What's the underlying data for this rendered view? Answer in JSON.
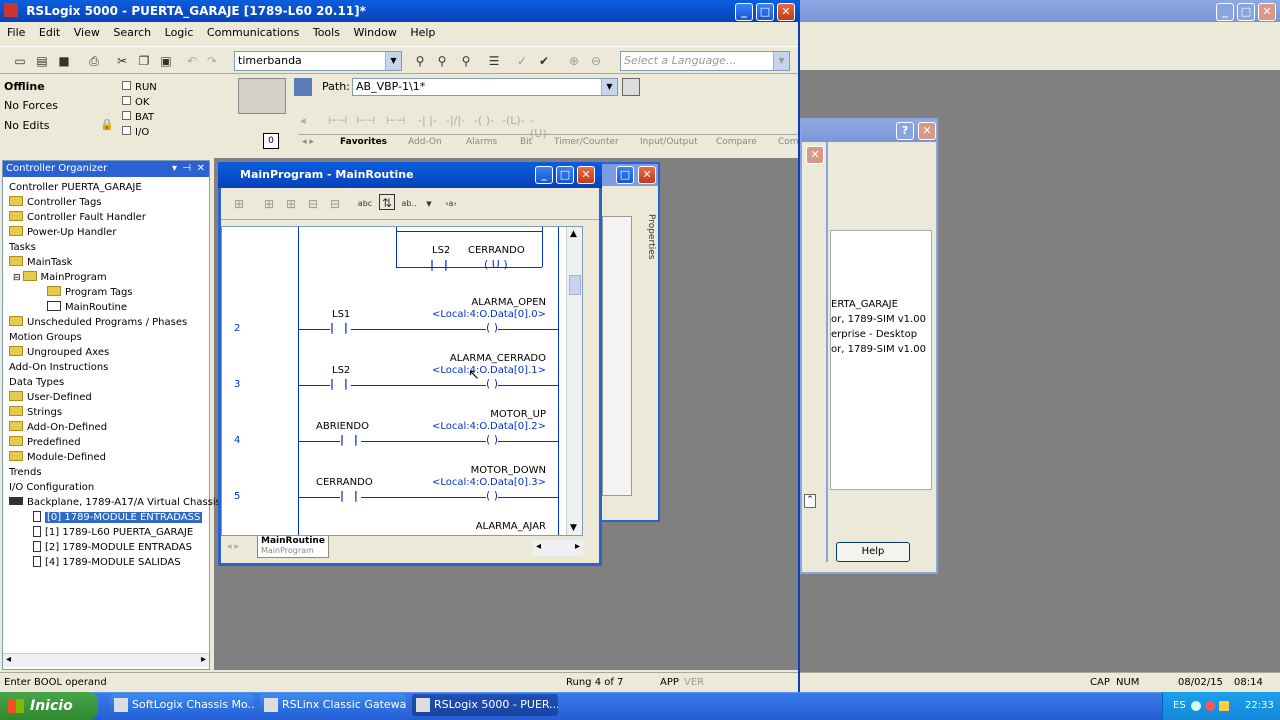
{
  "main_window": {
    "title": "RSLogix 5000 - PUERTA_GARAJE [1789-L60 20.11]*",
    "menu": [
      "File",
      "Edit",
      "View",
      "Search",
      "Logic",
      "Communications",
      "Tools",
      "Window",
      "Help"
    ],
    "search_value": "timerbanda",
    "language_placeholder": "Select a Language...",
    "path_label": "Path:",
    "path_value": "AB_VBP-1\\1*"
  },
  "status_panel": {
    "mode": "Offline",
    "forces": "No Forces",
    "edits": "No Edits",
    "run": "RUN",
    "ok": "OK",
    "bat": "BAT",
    "io": "I/O"
  },
  "instruction_tabs": [
    "Favorites",
    "Add-On",
    "Alarms",
    "Bit",
    "Timer/Counter",
    "Input/Output",
    "Compare",
    "Com"
  ],
  "organizer": {
    "title": "Controller Organizer",
    "items": [
      "Controller PUERTA_GARAJE",
      "Controller Tags",
      "Controller Fault Handler",
      "Power-Up Handler",
      "Tasks",
      "MainTask",
      "MainProgram",
      "Program Tags",
      "MainRoutine",
      "Unscheduled Programs / Phases",
      "Motion Groups",
      "Ungrouped Axes",
      "Add-On Instructions",
      "Data Types",
      "User-Defined",
      "Strings",
      "Add-On-Defined",
      "Predefined",
      "Module-Defined",
      "Trends",
      "I/O Configuration",
      "Backplane, 1789-A17/A Virtual Chassis",
      "[0] 1789-MODULE ENTRADASS",
      "[1] 1789-L60 PUERTA_GARAJE",
      "[2] 1789-MODULE ENTRADAS",
      "[4] 1789-MODULE SALIDAS"
    ]
  },
  "routine_window": {
    "title": "MainProgram - MainRoutine",
    "tab_label": "MainRoutine",
    "tab_sub": "MainProgram",
    "rungs": [
      {
        "num": "",
        "contact": "LS2",
        "coil_tag": "CERRANDO",
        "coil_addr": ""
      },
      {
        "num": "2",
        "contact": "LS1",
        "coil_tag": "ALARMA_OPEN",
        "coil_addr": "<Local:4:O.Data[0].0>"
      },
      {
        "num": "3",
        "contact": "LS2",
        "coil_tag": "ALARMA_CERRADO",
        "coil_addr": "<Local:4:O.Data[0].1>"
      },
      {
        "num": "4",
        "contact": "ABRIENDO",
        "coil_tag": "MOTOR_UP",
        "coil_addr": "<Local:4:O.Data[0].2>"
      },
      {
        "num": "5",
        "contact": "CERRANDO",
        "coil_tag": "MOTOR_DOWN",
        "coil_addr": "<Local:4:O.Data[0].3>"
      },
      {
        "num": "",
        "contact": "",
        "coil_tag": "ALARMA_AJAR",
        "coil_addr": ""
      }
    ]
  },
  "properties_label": "Properties",
  "side_dialog": {
    "lines": [
      "ERTA_GARAJE",
      "or, 1789-SIM v1.00",
      "erprise - Desktop",
      "or, 1789-SIM v1.00"
    ],
    "help_label": "Help"
  },
  "statusbar": {
    "hint": "Enter BOOL operand",
    "rung": "Rung 4 of 7",
    "app": "APP",
    "ver": "VER",
    "cap": "CAP",
    "num": "NUM",
    "date": "08/02/15",
    "time": "08:14 PM"
  },
  "taskbar": {
    "start": "Inicio",
    "buttons": [
      "SoftLogix Chassis Mo...",
      "RSLinx Classic Gateway",
      "RSLogix 5000 - PUER..."
    ],
    "lang": "ES",
    "clock": "22:33"
  }
}
